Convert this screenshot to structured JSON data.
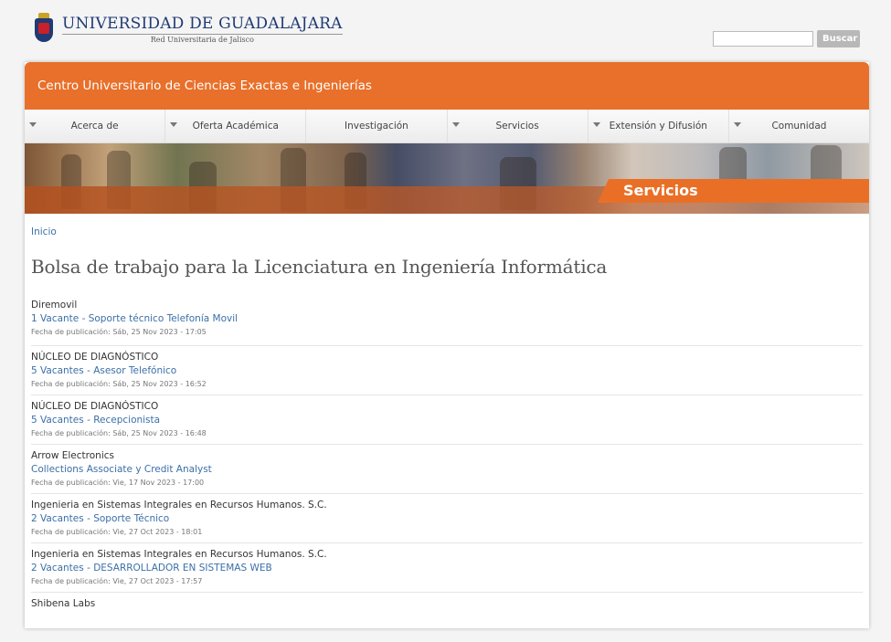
{
  "header": {
    "logo_title": "UNIVERSIDAD DE GUADALAJARA",
    "logo_subtitle": "Red Universitaria de Jalisco",
    "search_placeholder": "",
    "search_button": "Buscar"
  },
  "banner": {
    "title": "Centro Universitario de Ciencias Exactas e Ingenierías"
  },
  "nav": [
    {
      "label": "Acerca de",
      "has_dropdown": true
    },
    {
      "label": "Oferta Académica",
      "has_dropdown": true
    },
    {
      "label": "Investigación",
      "has_dropdown": false
    },
    {
      "label": "Servicios",
      "has_dropdown": true
    },
    {
      "label": "Extensión y Difusión",
      "has_dropdown": true
    },
    {
      "label": "Comunidad",
      "has_dropdown": true
    }
  ],
  "hero": {
    "section_label": "Servicios"
  },
  "breadcrumb": {
    "home": "Inicio"
  },
  "page": {
    "title": "Bolsa de trabajo para la Licenciatura en Ingeniería Informática"
  },
  "jobs": [
    {
      "company": "Diremovil",
      "title": "1 Vacante - Soporte técnico Telefonía Movil",
      "date": "Fecha de publicación: Sáb, 25 Nov 2023 - 17:05"
    },
    {
      "company": "NÚCLEO DE DIAGNÓSTICO",
      "title": "5 Vacantes - Asesor Telefónico",
      "date": "Fecha de publicación: Sáb, 25 Nov 2023 - 16:52"
    },
    {
      "company": "NÚCLEO DE DIAGNÓSTICO",
      "title": "5 Vacantes - Recepcionista",
      "date": "Fecha de publicación: Sáb, 25 Nov 2023 - 16:48"
    },
    {
      "company": "Arrow Electronics",
      "title": "Collections Associate y Credit Analyst",
      "date": "Fecha de publicación: Vie, 17 Nov 2023 - 17:00"
    },
    {
      "company": "Ingenieria en Sistemas Integrales en Recursos Humanos. S.C.",
      "title": "2 Vacantes - Soporte Técnico",
      "date": "Fecha de publicación: Vie, 27 Oct 2023 - 18:01"
    },
    {
      "company": "Ingenieria en Sistemas Integrales en Recursos Humanos. S.C.",
      "title": "2 Vacantes - DESARROLLADOR EN SISTEMAS WEB",
      "date": "Fecha de publicación: Vie, 27 Oct 2023 - 17:57"
    },
    {
      "company": "Shibena Labs",
      "title": "",
      "date": ""
    }
  ],
  "colors": {
    "accent": "#e8702a",
    "link": "#3b6fa8",
    "brand_blue": "#1f3a74"
  }
}
